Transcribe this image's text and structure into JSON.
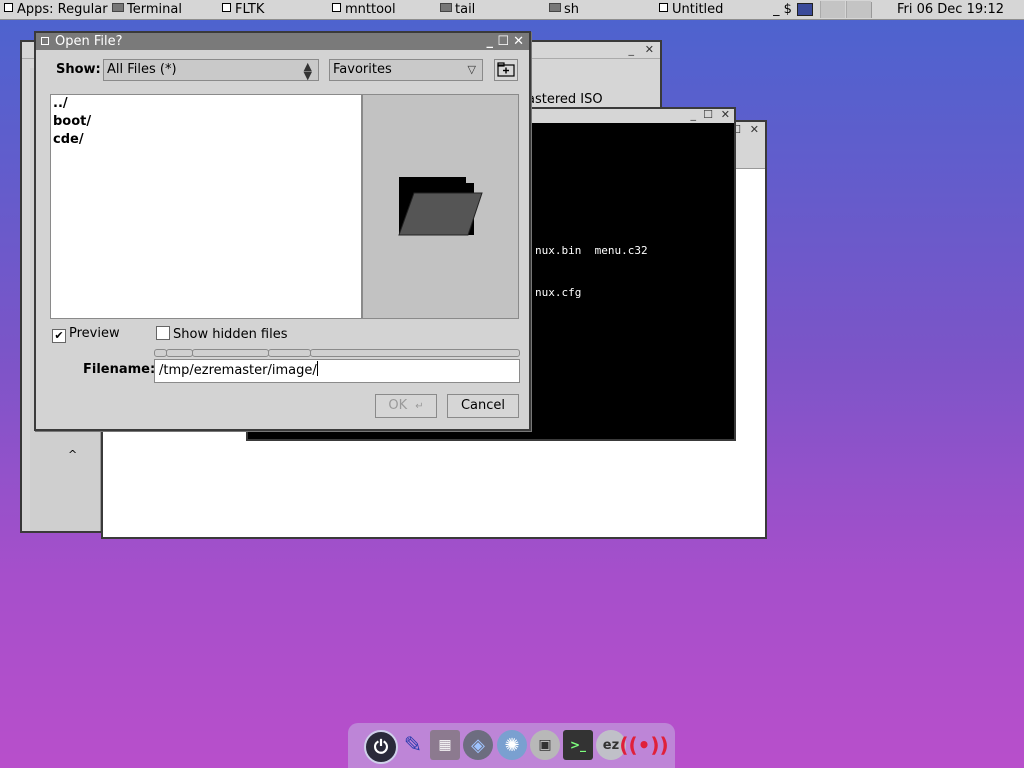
{
  "taskbar": {
    "apps_label": "Apps: Regular",
    "windows": [
      "Terminal",
      "FLTK",
      "mnttool",
      "tail",
      "sh",
      "Untitled"
    ],
    "indicator": "_ $",
    "clock": "Fri 06 Dec 19:12"
  },
  "bg_window": {
    "fragment": "astered ISO"
  },
  "terminal": {
    "line1": "nux.bin  menu.c32",
    "line2": "nux.cfg"
  },
  "dialog": {
    "title": "Open File?",
    "show_label": "Show:",
    "filter_value": "All Files (*)",
    "favorites_label": "Favorites",
    "files": [
      "../",
      "boot/",
      "cde/"
    ],
    "preview_label": "Preview",
    "preview_checked": true,
    "hidden_label": "Show hidden files",
    "hidden_checked": false,
    "filename_label": "Filename:",
    "filename_value": "/tmp/ezremaster/image/",
    "ok_label": "OK",
    "cancel_label": "Cancel"
  },
  "dock": {
    "icons": [
      "power-icon",
      "paint-brush-icon",
      "image-editor-icon",
      "network-icon",
      "runner-icon",
      "drive-icon",
      "terminal-icon",
      "ezremaster-icon",
      "wireless-icon"
    ],
    "ez_label": "ez"
  },
  "colors": {
    "title_active": "#7a7a7a",
    "terminal_bg": "#000000",
    "terminal_fg": "#ffffff"
  }
}
